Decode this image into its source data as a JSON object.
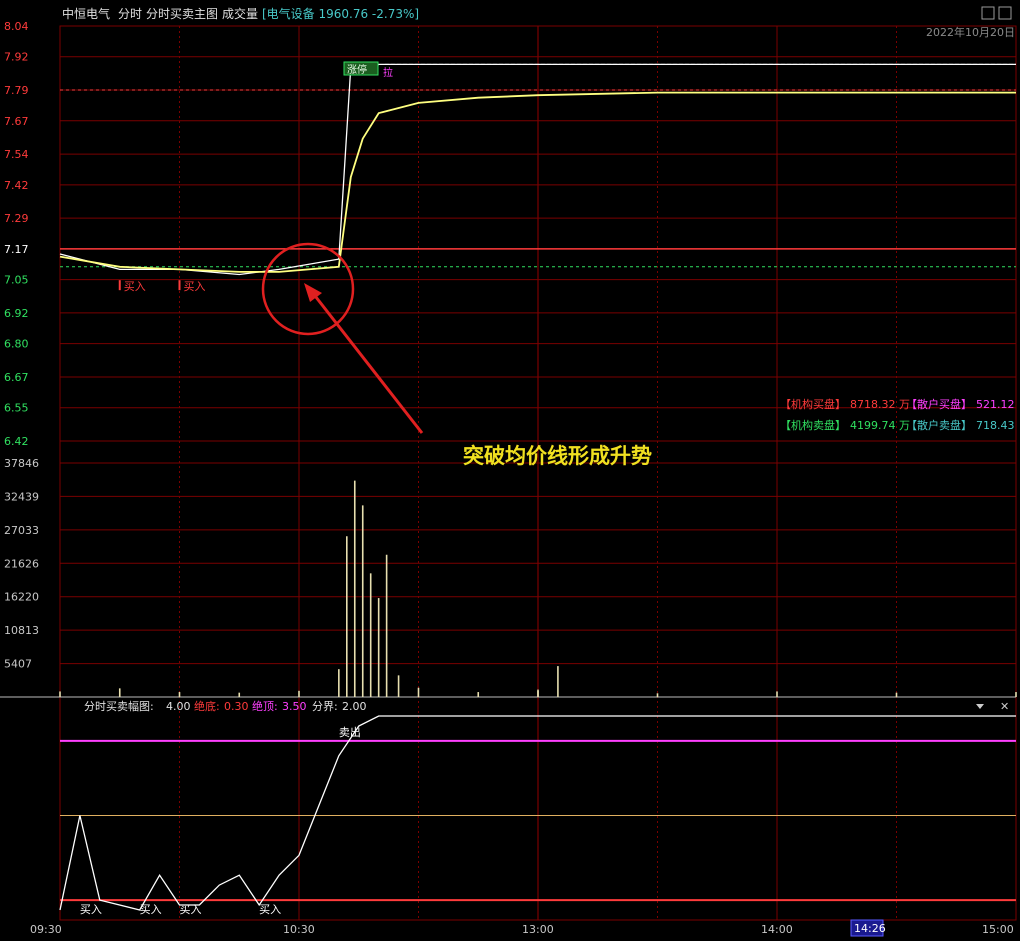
{
  "header": {
    "stock_name": "中恒电气",
    "period": "分时",
    "indicator": "分时买卖主图",
    "volume_label": "成交量",
    "sector": "[电气设备 1960.76 -2.73%]",
    "date": "2022年10月20日"
  },
  "colors": {
    "grid": "#7a0000",
    "up": "#ff3b3b",
    "down": "#30e060",
    "price": "#ffffff",
    "avg": "#ffff80",
    "cyan": "#48c8c8",
    "magenta": "#ff40ff",
    "annot": "#f0e020"
  },
  "annotation": {
    "text": "突破均价线形成升势"
  },
  "tags": {
    "limit_up": "涨停",
    "la": "拉"
  },
  "stats": [
    {
      "b1": "【机构买盘】",
      "v1": "8718.32 万",
      "b2": "【散户买盘】",
      "v2": "521.12"
    },
    {
      "b1": "【机构卖盘】",
      "v1": "4199.74 万",
      "b2": "【散户卖盘】",
      "v2": "718.43"
    }
  ],
  "osc_header": {
    "name": "分时买卖幅图:",
    "value": "4.00",
    "bottom_label": "绝底:",
    "bottom_val": "0.30",
    "top_label": "绝顶:",
    "top_val": "3.50",
    "mid_label": "分界:",
    "mid_val": "2.00"
  },
  "signals": {
    "buy": "买入",
    "sell": "卖出"
  },
  "cursor_time": "14:26",
  "chart_data": [
    {
      "type": "line",
      "title": "中恒电气 分时",
      "ylim": [
        6.42,
        8.04
      ],
      "y_ticks": [
        "8.04",
        "7.92",
        "7.79",
        "7.67",
        "7.54",
        "7.42",
        "7.29",
        "7.17",
        "7.05",
        "6.92",
        "6.80",
        "6.67",
        "6.55",
        "6.42"
      ],
      "prev_close": 7.17,
      "limit_price": 7.89,
      "x_ticks": [
        "09:30",
        "10:30",
        "13:00",
        "14:00",
        "15:00"
      ],
      "x": [
        "09:30",
        "09:45",
        "10:00",
        "10:15",
        "10:25",
        "10:40",
        "10:43",
        "10:46",
        "10:50",
        "11:00",
        "11:15",
        "11:30",
        "13:30",
        "14:00",
        "14:30",
        "15:00"
      ],
      "series": [
        {
          "values": [
            7.15,
            7.09,
            7.09,
            7.07,
            7.09,
            7.13,
            7.88,
            7.85,
            7.89,
            7.89,
            7.89,
            7.89,
            7.89,
            7.89,
            7.89,
            7.89
          ]
        },
        {
          "values": [
            7.14,
            7.1,
            7.09,
            7.08,
            7.08,
            7.1,
            7.45,
            7.6,
            7.7,
            7.74,
            7.76,
            7.77,
            7.78,
            7.78,
            7.78,
            7.78
          ]
        }
      ],
      "signals": [
        {
          "label": "买入",
          "time": "09:45",
          "price": 7.04
        },
        {
          "label": "买入",
          "time": "10:00",
          "price": 7.04
        }
      ]
    },
    {
      "type": "bar",
      "title": "成交量",
      "ylim": [
        0,
        37846
      ],
      "y_ticks": [
        "37846",
        "32439",
        "27033",
        "21626",
        "16220",
        "10813",
        "5407"
      ],
      "x": [
        "09:30",
        "09:45",
        "10:00",
        "10:15",
        "10:30",
        "10:40",
        "10:42",
        "10:44",
        "10:46",
        "10:48",
        "10:50",
        "10:52",
        "10:55",
        "11:00",
        "11:15",
        "11:30",
        "13:00",
        "13:05",
        "13:30",
        "14:00",
        "14:30",
        "15:00"
      ],
      "values": [
        900,
        1400,
        800,
        700,
        1000,
        4500,
        26000,
        35000,
        31000,
        20000,
        16000,
        23000,
        3500,
        1500,
        800,
        1200,
        1000,
        5000,
        600,
        900,
        700,
        800
      ]
    },
    {
      "type": "line",
      "title": "分时买卖幅图",
      "ylim": [
        0,
        4
      ],
      "levels": {
        "top": 3.5,
        "mid": 2.0,
        "bottom": 0.3
      },
      "x": [
        "09:30",
        "09:35",
        "09:40",
        "09:50",
        "09:55",
        "10:00",
        "10:05",
        "10:10",
        "10:15",
        "10:20",
        "10:25",
        "10:30",
        "10:35",
        "10:40",
        "10:45",
        "10:50",
        "11:00",
        "11:30",
        "13:00",
        "15:00"
      ],
      "values": [
        0.1,
        2.0,
        0.3,
        0.1,
        0.8,
        0.2,
        0.2,
        0.6,
        0.8,
        0.2,
        0.8,
        1.2,
        2.2,
        3.2,
        3.8,
        4.0,
        4.0,
        4.0,
        4.0,
        4.0
      ],
      "signals": [
        {
          "label": "买入",
          "time": "09:35"
        },
        {
          "label": "买入",
          "time": "09:50"
        },
        {
          "label": "买入",
          "time": "10:00"
        },
        {
          "label": "买入",
          "time": "10:20"
        },
        {
          "label": "卖出",
          "time": "10:40"
        }
      ]
    }
  ]
}
